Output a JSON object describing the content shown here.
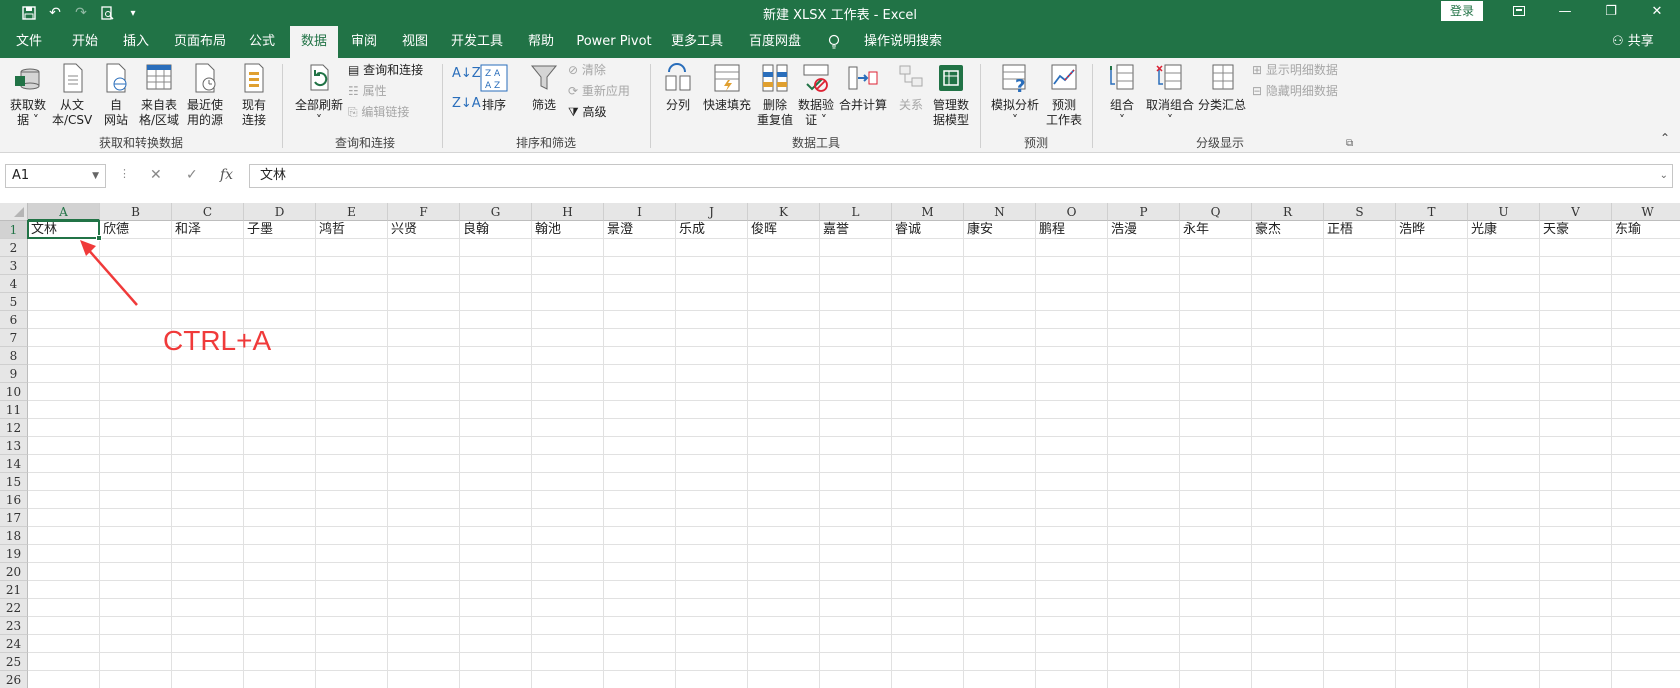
{
  "window": {
    "title": "新建 XLSX 工作表  -  Excel",
    "login_label": "登录",
    "share_label": "共享"
  },
  "tabs": [
    "文件",
    "开始",
    "插入",
    "页面布局",
    "公式",
    "数据",
    "审阅",
    "视图",
    "开发工具",
    "帮助",
    "Power Pivot",
    "更多工具",
    "百度网盘",
    "操作说明搜索"
  ],
  "ribbon": {
    "get_data": "获取数\n据 ˅",
    "from_csv": "从文\n本/CSV",
    "from_web": "自\n网站",
    "from_table": "来自表\n格/区域",
    "recent_sources": "最近使\n用的源",
    "existing_conn": "现有\n连接",
    "group_get": "获取和转换数据",
    "refresh_all": "全部刷新\n˅",
    "queries_conn": "查询和连接",
    "properties": "属性",
    "edit_links": "编辑链接",
    "group_queries": "查询和连接",
    "sort": "排序",
    "filter": "筛选",
    "clear": "清除",
    "reapply": "重新应用",
    "advanced": "高级",
    "group_sort": "排序和筛选",
    "text_to_columns": "分列",
    "flash_fill": "快速填充",
    "remove_dup": "删除\n重复值",
    "data_validation": "数据验\n证 ˅",
    "consolidate": "合并计算",
    "relationships": "关系",
    "manage_model": "管理数\n据模型",
    "group_tools": "数据工具",
    "what_if": "模拟分析\n˅",
    "forecast_sheet": "预测\n工作表",
    "group_forecast": "预测",
    "group_btn": "组合\n˅",
    "ungroup_btn": "取消组合\n˅",
    "subtotal": "分类汇总",
    "show_detail": "显示明细数据",
    "hide_detail": "隐藏明细数据",
    "group_outline": "分级显示"
  },
  "formula_bar": {
    "name_box": "A1",
    "fx_symbol": "fx",
    "content": "文林"
  },
  "sheet": {
    "columns": [
      "A",
      "B",
      "C",
      "D",
      "E",
      "F",
      "G",
      "H",
      "I",
      "J",
      "K",
      "L",
      "M",
      "N",
      "O",
      "P",
      "Q",
      "R",
      "S",
      "T",
      "U",
      "V",
      "W"
    ],
    "row_numbers": [
      "1",
      "2",
      "3",
      "4",
      "5",
      "6",
      "7",
      "8",
      "9",
      "10",
      "11",
      "12",
      "13",
      "14",
      "15",
      "16",
      "17",
      "18",
      "19",
      "20",
      "21",
      "22",
      "23",
      "24",
      "25",
      "26"
    ],
    "row1_values": [
      "文林",
      "欣德",
      "和泽",
      "子墨",
      "鸿哲",
      "兴贤",
      "良翰",
      "翰池",
      "景澄",
      "乐成",
      "俊晖",
      "嘉誉",
      "睿诚",
      "康安",
      "鹏程",
      "浩漫",
      "永年",
      "豪杰",
      "正梧",
      "浩晔",
      "光康",
      "天豪",
      "东瑜"
    ],
    "selected_cell": "A1"
  },
  "annotation": {
    "text": "CTRL+A",
    "color": "#f03a3a"
  },
  "colors": {
    "accent": "#217346",
    "ribbon_bg": "#f3f3f3"
  }
}
